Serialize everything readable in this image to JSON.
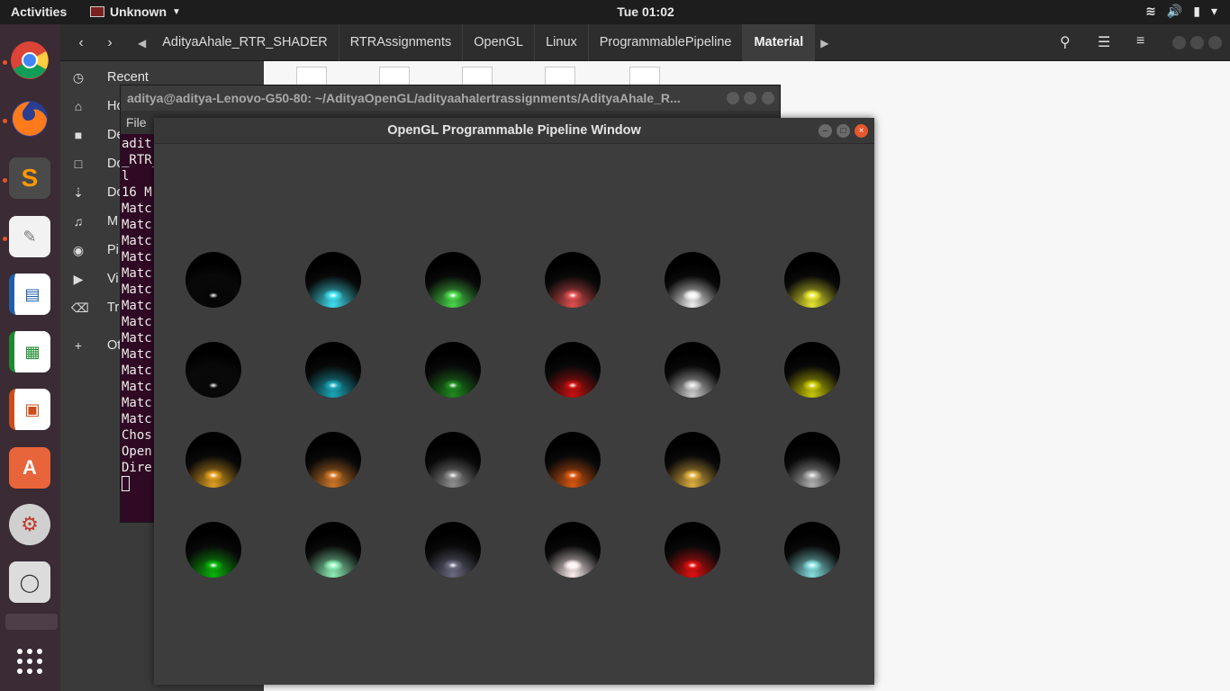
{
  "topbar": {
    "activities": "Activities",
    "app_name": "Unknown",
    "clock": "Tue 01:02",
    "tray_icons": [
      "wifi-icon",
      "volume-icon",
      "battery-icon",
      "power-menu-icon"
    ]
  },
  "dock": {
    "apps": [
      "chrome",
      "firefox",
      "sublime-text",
      "text-editor",
      "libreoffice-writer",
      "libreoffice-calc",
      "libreoffice-impress",
      "software-center",
      "system-settings",
      "screenshot"
    ],
    "show_apps_icon": "grid-icon"
  },
  "file_manager": {
    "breadcrumbs": [
      "AdityaAhale_RTR_SHADER",
      "RTRAssignments",
      "OpenGL",
      "Linux",
      "ProgrammablePipeline",
      "Material"
    ],
    "active_crumb": "Material",
    "sidebar": [
      {
        "icon": "clock-icon",
        "label": "Recent"
      },
      {
        "icon": "home-icon",
        "label": "Ho"
      },
      {
        "icon": "folder-icon",
        "label": "De"
      },
      {
        "icon": "document-icon",
        "label": "Do"
      },
      {
        "icon": "download-icon",
        "label": "Do"
      },
      {
        "icon": "music-icon",
        "label": "M"
      },
      {
        "icon": "camera-icon",
        "label": "Pi"
      },
      {
        "icon": "video-icon",
        "label": "Vi"
      },
      {
        "icon": "trash-icon",
        "label": "Tr"
      },
      {
        "icon": "plus-icon",
        "label": "Ot"
      }
    ]
  },
  "terminal": {
    "title": "aditya@aditya-Lenovo-G50-80: ~/AdityaOpenGL/adityaahalertrassignments/AdityaAhale_R...",
    "menu": "File",
    "lines": [
      "adit",
      "_RTR_",
      "l",
      "16 M",
      "Matc",
      "Matc",
      "Matc",
      "Matc",
      "Matc",
      "Matc",
      "Matc",
      "Matc",
      "Matc",
      "Matc",
      "Matc",
      "Matc",
      "Matc",
      "Matc",
      "Chos",
      "Open",
      "Dire"
    ]
  },
  "gl_window": {
    "title": "OpenGL Programmable Pipeline Window",
    "rows": 4,
    "cols": 6,
    "sphere_colors": [
      [
        "#050505",
        "#3fe0f0",
        "#4ad84a",
        "#e05050",
        "#f0f0f0",
        "#e8e830"
      ],
      [
        "#080808",
        "#1aa8b8",
        "#1f8a1f",
        "#c81010",
        "#cccccc",
        "#c8c800"
      ],
      [
        "#e0a020",
        "#d07828",
        "#909090",
        "#d85810",
        "#e0b040",
        "#b0b0b0"
      ],
      [
        "#0ab40a",
        "#8ff0b8",
        "#6a6a80",
        "#fff0f0",
        "#e01010",
        "#88e0e0"
      ]
    ]
  }
}
